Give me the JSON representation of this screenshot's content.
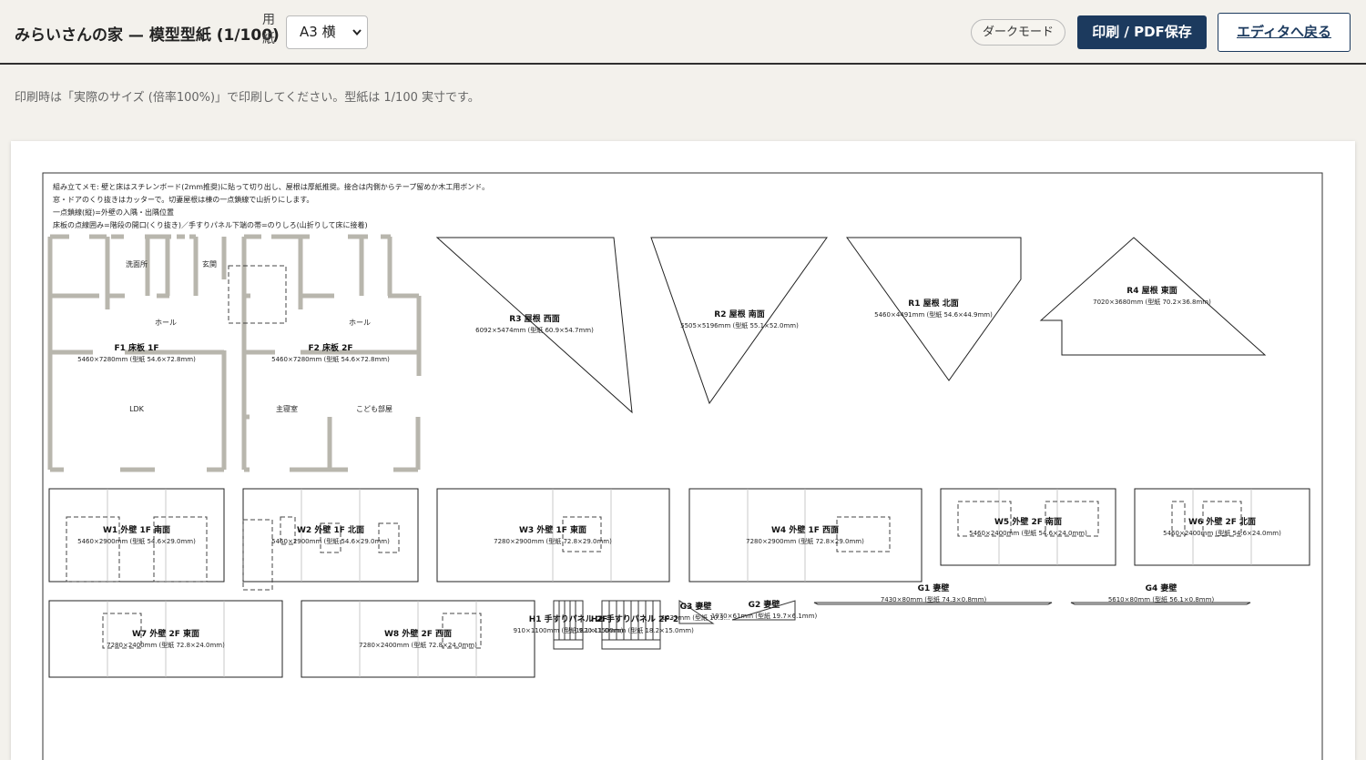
{
  "header": {
    "title": "みらいさんの家 — 模型型紙 (1/100)",
    "paper_label": "用紙",
    "paper_value": "A3 横",
    "dark_mode_label": "ダークモード",
    "print_label": "印刷 / PDF保存",
    "back_label": "エディタへ戻る"
  },
  "hint": "印刷時は「実際のサイズ (倍率100%)」で印刷してください。型紙は 1/100 実寸です。",
  "sheet": {
    "notes": [
      "組み立てメモ: 壁と床はスチレンボード(2mm推奨)に貼って切り出し、屋根は厚紙推奨。接合は内側からテープ留めか木工用ボンド。",
      "窓・ドアのくり抜きはカッターで。切妻屋根は棟の一点鎖線で山折りにします。",
      "一点鎖線(縦)=外壁の入隅・出隅位置",
      "床板の点線囲み=階段の開口(くり抜き)／手すりパネル下端の帯=のりしろ(山折りして床に接着)"
    ],
    "floors": {
      "f1": {
        "title": "F1 床板 1F",
        "dims": "5460×7280mm (型紙 54.6×72.8mm)",
        "rooms": [
          "洗面所",
          "玄関",
          "ホール",
          "LDK"
        ]
      },
      "f2": {
        "title": "F2 床板 2F",
        "dims": "5460×7280mm (型紙 54.6×72.8mm)",
        "rooms": [
          "ホール",
          "主寝室",
          "こども部屋"
        ]
      }
    },
    "roofs": {
      "r3": {
        "title": "R3 屋根 西面",
        "dims": "6092×5474mm (型紙 60.9×54.7mm)"
      },
      "r2": {
        "title": "R2 屋根 南面",
        "dims": "5505×5196mm (型紙 55.1×52.0mm)"
      },
      "r1": {
        "title": "R1 屋根 北面",
        "dims": "5460×4491mm (型紙 54.6×44.9mm)"
      },
      "r4": {
        "title": "R4 屋根 東面",
        "dims": "7020×3680mm (型紙 70.2×36.8mm)"
      }
    },
    "walls": {
      "w1": {
        "title": "W1 外壁 1F 南面",
        "dims": "5460×2900mm (型紙 54.6×29.0mm)"
      },
      "w2": {
        "title": "W2 外壁 1F 北面",
        "dims": "5460×2900mm (型紙 54.6×29.0mm)"
      },
      "w3": {
        "title": "W3 外壁 1F 東面",
        "dims": "7280×2900mm (型紙 72.8×29.0mm)"
      },
      "w4": {
        "title": "W4 外壁 1F 西面",
        "dims": "7280×2900mm (型紙 72.8×29.0mm)"
      },
      "w5": {
        "title": "W5 外壁 2F 南面",
        "dims": "5460×2400mm (型紙 54.6×24.0mm)"
      },
      "w6": {
        "title": "W6 外壁 2F 北面",
        "dims": "5460×2400mm (型紙 54.6×24.0mm)"
      },
      "w7": {
        "title": "W7 外壁 2F 東面",
        "dims": "7280×2400mm (型紙 72.8×24.0mm)"
      },
      "w8": {
        "title": "W8 外壁 2F 西面",
        "dims": "7280×2400mm (型紙 72.8×24.0mm)"
      }
    },
    "gables": {
      "g1": {
        "title": "G1 妻壁",
        "dims": "7430×80mm (型紙 74.3×0.8mm)"
      },
      "g4": {
        "title": "G4 妻壁",
        "dims": "5610×80mm (型紙 56.1×0.8mm)"
      },
      "g3": {
        "title": "G3 妻壁",
        "dims": "1033mm (型紙 10.3..."
      },
      "g2": {
        "title": "G2 妻壁",
        "dims": "1970×61mm (型紙 19.7×6.1mm)"
      }
    },
    "handrails": {
      "h1": {
        "title": "H1 手すりパネル 2F",
        "dims": "910×1100mm (型紙 9.1×11.0mm)"
      },
      "h2": {
        "title": "H2 手すりパネル 2F-2",
        "dims": "1820×1500mm (型紙 18.2×15.0mm)"
      }
    }
  }
}
